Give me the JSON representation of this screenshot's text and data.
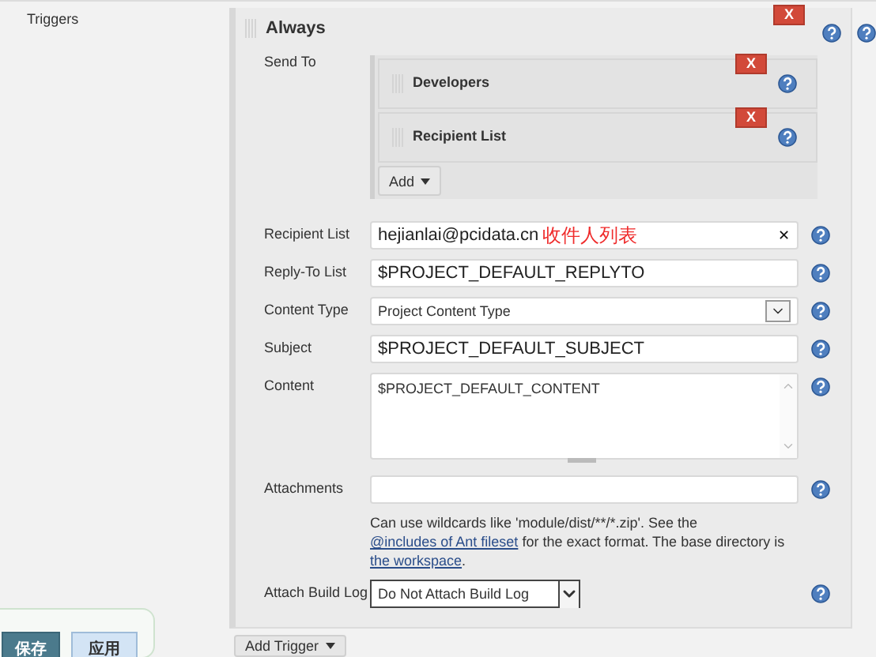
{
  "sidebar": {
    "label": "Triggers"
  },
  "trigger": {
    "title": "Always",
    "delete": "X",
    "send_to": {
      "label": "Send To",
      "add_button": "Add",
      "recipients": [
        {
          "name": "Developers",
          "delete": "X"
        },
        {
          "name": "Recipient List",
          "delete": "X"
        }
      ]
    },
    "fields": [
      {
        "kind": "text",
        "label": "Recipient List",
        "value": "hejianlai@pcidata.cn",
        "annotation": "收件人列表",
        "clear": "✕"
      },
      {
        "kind": "text",
        "label": "Reply-To List",
        "value": "$PROJECT_DEFAULT_REPLYTO"
      },
      {
        "kind": "select",
        "label": "Content Type",
        "value": "Project Content Type"
      },
      {
        "kind": "text",
        "label": "Subject",
        "value": "$PROJECT_DEFAULT_SUBJECT"
      },
      {
        "kind": "textarea",
        "label": "Content",
        "value": "$PROJECT_DEFAULT_CONTENT"
      },
      {
        "kind": "text",
        "label": "Attachments"
      },
      {
        "kind": "hint",
        "parts": [
          {
            "kind": "text",
            "text": "Can use wildcards like 'module/dist/**/*.zip'. See the "
          },
          {
            "kind": "link",
            "text": "@includes of Ant fileset"
          },
          {
            "kind": "text",
            "text": " for the exact format. The base directory is "
          },
          {
            "kind": "link",
            "text": "the workspace"
          },
          {
            "kind": "text",
            "text": "."
          }
        ]
      },
      {
        "kind": "dark-select",
        "label": "Attach Build Log",
        "value": "Do Not Attach Build Log"
      }
    ]
  },
  "add_trigger": "Add Trigger",
  "buttons": [
    {
      "label": "保存",
      "primary": true
    },
    {
      "label": "应用",
      "primary": false
    }
  ]
}
